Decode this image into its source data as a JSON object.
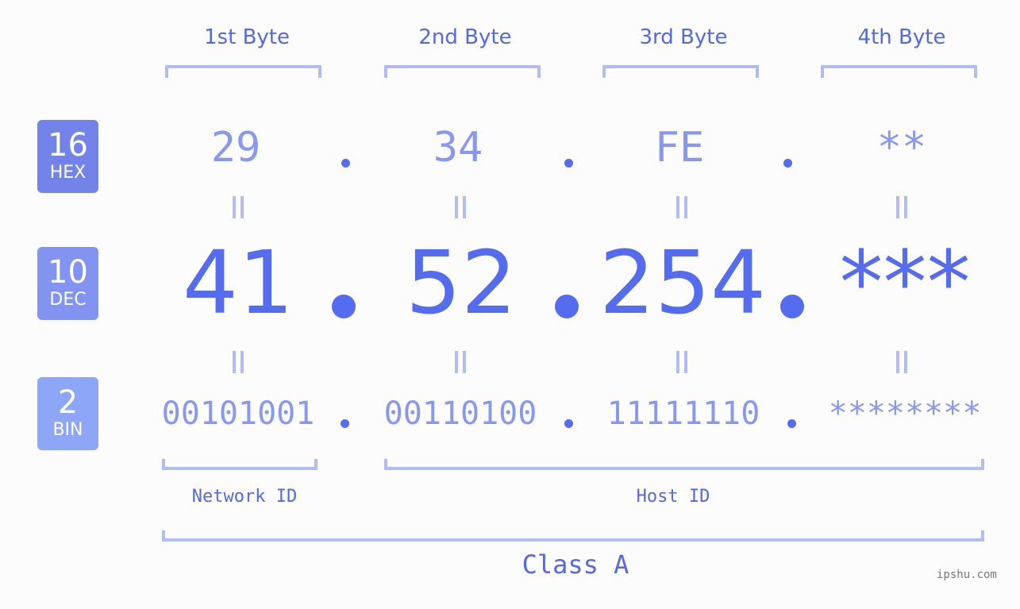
{
  "bytes": {
    "headers": [
      "1st Byte",
      "2nd Byte",
      "3rd Byte",
      "4th Byte"
    ]
  },
  "badges": {
    "hex": {
      "number": "16",
      "label": "HEX",
      "color": "#7483ea"
    },
    "dec": {
      "number": "10",
      "label": "DEC",
      "color": "#8293f1"
    },
    "bin": {
      "number": "2",
      "label": "BIN",
      "color": "#8ea6f8"
    }
  },
  "hex_values": [
    "29",
    "34",
    "FE",
    "**"
  ],
  "dec_values": [
    "41",
    "52",
    "254",
    "***"
  ],
  "bin_values": [
    "00101001",
    "00110100",
    "11111110",
    "********"
  ],
  "id_labels": {
    "network": "Network ID",
    "host": "Host ID"
  },
  "class_label": "Class A",
  "watermark": "ipshu.com",
  "colors": {
    "primary": "#556cee",
    "light": "#8898f0",
    "bracket": "#b2bcf4",
    "background": "#fbfcfb"
  }
}
